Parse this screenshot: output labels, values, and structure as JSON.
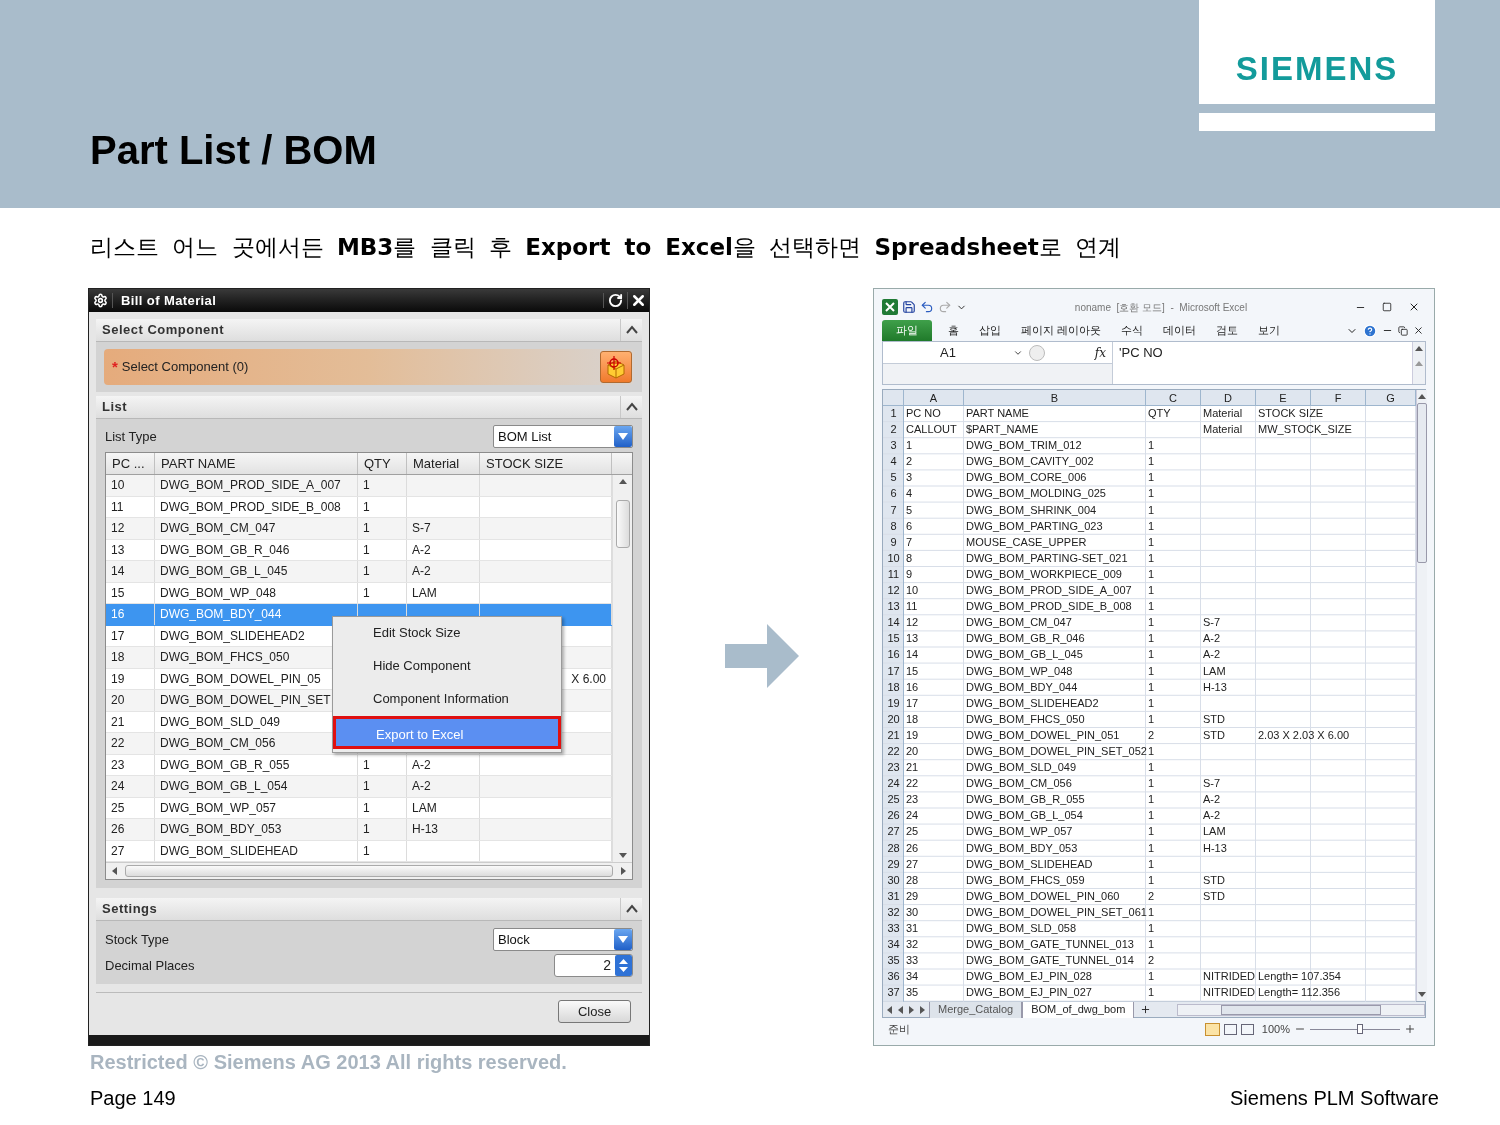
{
  "slide": {
    "title": "Part List / BOM",
    "logo": "SIEMENS",
    "subtitle": "리스트 어느 곳에서든 **MB3**를 클릭 후 **Export to Excel**을 선택하면 **Spreadsheet**로 연계",
    "footer_notice": "Restricted © Siemens AG 2013 All rights reserved.",
    "page": "Page 149",
    "company": "Siemens PLM Software"
  },
  "dialog": {
    "title": "Bill of Material",
    "select_section": {
      "title": "Select Component",
      "expanded": true,
      "required_mark": "*",
      "label": "Select Component (0)"
    },
    "list_section": {
      "title": "List",
      "expanded": true,
      "list_type_label": "List Type",
      "list_type_value": "BOM List",
      "columns": [
        "PC ...",
        "PART NAME",
        "QTY",
        "Material",
        "STOCK SIZE"
      ],
      "rows": [
        {
          "pc": "10",
          "name": "DWG_BOM_PROD_SIDE_A_007",
          "qty": "1",
          "selected": false
        },
        {
          "pc": "11",
          "name": "DWG_BOM_PROD_SIDE_B_008",
          "qty": "1",
          "selected": false
        },
        {
          "pc": "12",
          "name": "DWG_BOM_CM_047",
          "qty": "1",
          "material": "S-7",
          "selected": false
        },
        {
          "pc": "13",
          "name": "DWG_BOM_GB_R_046",
          "qty": "1",
          "material": "A-2",
          "selected": false
        },
        {
          "pc": "14",
          "name": "DWG_BOM_GB_L_045",
          "qty": "1",
          "material": "A-2",
          "selected": false
        },
        {
          "pc": "15",
          "name": "DWG_BOM_WP_048",
          "qty": "1",
          "material": "LAM",
          "selected": false
        },
        {
          "pc": "16",
          "name": "DWG_BOM_BDY_044",
          "selected": true
        },
        {
          "pc": "17",
          "name": "DWG_BOM_SLIDEHEAD2",
          "selected": false
        },
        {
          "pc": "18",
          "name": "DWG_BOM_FHCS_050",
          "selected": false
        },
        {
          "pc": "19",
          "name": "DWG_BOM_DOWEL_PIN_05",
          "stock": "X 6.00",
          "selected": false
        },
        {
          "pc": "20",
          "name": "DWG_BOM_DOWEL_PIN_SET",
          "selected": false
        },
        {
          "pc": "21",
          "name": "DWG_BOM_SLD_049",
          "selected": false
        },
        {
          "pc": "22",
          "name": "DWG_BOM_CM_056",
          "selected": false
        },
        {
          "pc": "23",
          "name": "DWG_BOM_GB_R_055",
          "qty": "1",
          "material": "A-2",
          "selected": false
        },
        {
          "pc": "24",
          "name": "DWG_BOM_GB_L_054",
          "qty": "1",
          "material": "A-2",
          "selected": false
        },
        {
          "pc": "25",
          "name": "DWG_BOM_WP_057",
          "qty": "1",
          "material": "LAM",
          "selected": false
        },
        {
          "pc": "26",
          "name": "DWG_BOM_BDY_053",
          "qty": "1",
          "material": "H-13",
          "selected": false
        },
        {
          "pc": "27",
          "name": "DWG_BOM_SLIDEHEAD",
          "qty": "1",
          "selected": false
        }
      ],
      "context_menu": [
        {
          "label": "Edit Stock Size",
          "selected": false
        },
        {
          "label": "Hide Component",
          "selected": false
        },
        {
          "label": "Component Information",
          "selected": false
        },
        {
          "label": "Export to Excel",
          "selected": true
        }
      ]
    },
    "settings_section": {
      "title": "Settings",
      "expanded": true,
      "stock_type_label": "Stock Type",
      "stock_type_value": "Block",
      "decimal_label": "Decimal Places",
      "decimal_value": "2"
    },
    "close_button": "Close"
  },
  "excel": {
    "title": "noname  [호환 모드]  -  Microsoft Excel",
    "ribbon_tabs": [
      {
        "label": "파일",
        "kind": "file"
      },
      {
        "label": "홈",
        "kind": "tab"
      },
      {
        "label": "삽입",
        "kind": "tab"
      },
      {
        "label": "페이지 레이아웃",
        "kind": "tab"
      },
      {
        "label": "수식",
        "kind": "tab"
      },
      {
        "label": "데이터",
        "kind": "tab"
      },
      {
        "label": "검토",
        "kind": "tab"
      },
      {
        "label": "보기",
        "kind": "tab"
      }
    ],
    "name_box": "A1",
    "formula": "'PC NO",
    "fx": "fx",
    "column_headers": [
      "A",
      "B",
      "C",
      "D",
      "E",
      "F",
      "G"
    ],
    "rows": [
      {
        "row": "1",
        "a": "PC NO",
        "b": "PART NAME",
        "c": "QTY",
        "d": "Material",
        "e": "STOCK SIZE"
      },
      {
        "row": "2",
        "a": "CALLOUT",
        "b": "$PART_NAME",
        "d": "Material",
        "e": "MW_STOCK_SIZE"
      },
      {
        "row": "3",
        "a": "1",
        "b": "DWG_BOM_TRIM_012",
        "c": "1"
      },
      {
        "row": "4",
        "a": "2",
        "b": "DWG_BOM_CAVITY_002",
        "c": "1"
      },
      {
        "row": "5",
        "a": "3",
        "b": "DWG_BOM_CORE_006",
        "c": "1"
      },
      {
        "row": "6",
        "a": "4",
        "b": "DWG_BOM_MOLDING_025",
        "c": "1"
      },
      {
        "row": "7",
        "a": "5",
        "b": "DWG_BOM_SHRINK_004",
        "c": "1"
      },
      {
        "row": "8",
        "a": "6",
        "b": "DWG_BOM_PARTING_023",
        "c": "1"
      },
      {
        "row": "9",
        "a": "7",
        "b": "MOUSE_CASE_UPPER",
        "c": "1"
      },
      {
        "row": "10",
        "a": "8",
        "b": "DWG_BOM_PARTING-SET_021",
        "c": "1"
      },
      {
        "row": "11",
        "a": "9",
        "b": "DWG_BOM_WORKPIECE_009",
        "c": "1"
      },
      {
        "row": "12",
        "a": "10",
        "b": "DWG_BOM_PROD_SIDE_A_007",
        "c": "1"
      },
      {
        "row": "13",
        "a": "11",
        "b": "DWG_BOM_PROD_SIDE_B_008",
        "c": "1"
      },
      {
        "row": "14",
        "a": "12",
        "b": "DWG_BOM_CM_047",
        "c": "1",
        "d": "S-7"
      },
      {
        "row": "15",
        "a": "13",
        "b": "DWG_BOM_GB_R_046",
        "c": "1",
        "d": "A-2"
      },
      {
        "row": "16",
        "a": "14",
        "b": "DWG_BOM_GB_L_045",
        "c": "1",
        "d": "A-2"
      },
      {
        "row": "17",
        "a": "15",
        "b": "DWG_BOM_WP_048",
        "c": "1",
        "d": "LAM"
      },
      {
        "row": "18",
        "a": "16",
        "b": "DWG_BOM_BDY_044",
        "c": "1",
        "d": "H-13"
      },
      {
        "row": "19",
        "a": "17",
        "b": "DWG_BOM_SLIDEHEAD2",
        "c": "1"
      },
      {
        "row": "20",
        "a": "18",
        "b": "DWG_BOM_FHCS_050",
        "c": "1",
        "d": "STD"
      },
      {
        "row": "21",
        "a": "19",
        "b": "DWG_BOM_DOWEL_PIN_051",
        "c": "2",
        "d": "STD",
        "e": "2.03 X 2.03 X 6.00"
      },
      {
        "row": "22",
        "a": "20",
        "b": "DWG_BOM_DOWEL_PIN_SET_052",
        "c": "1"
      },
      {
        "row": "23",
        "a": "21",
        "b": "DWG_BOM_SLD_049",
        "c": "1"
      },
      {
        "row": "24",
        "a": "22",
        "b": "DWG_BOM_CM_056",
        "c": "1",
        "d": "S-7"
      },
      {
        "row": "25",
        "a": "23",
        "b": "DWG_BOM_GB_R_055",
        "c": "1",
        "d": "A-2"
      },
      {
        "row": "26",
        "a": "24",
        "b": "DWG_BOM_GB_L_054",
        "c": "1",
        "d": "A-2"
      },
      {
        "row": "27",
        "a": "25",
        "b": "DWG_BOM_WP_057",
        "c": "1",
        "d": "LAM"
      },
      {
        "row": "28",
        "a": "26",
        "b": "DWG_BOM_BDY_053",
        "c": "1",
        "d": "H-13"
      },
      {
        "row": "29",
        "a": "27",
        "b": "DWG_BOM_SLIDEHEAD",
        "c": "1"
      },
      {
        "row": "30",
        "a": "28",
        "b": "DWG_BOM_FHCS_059",
        "c": "1",
        "d": "STD"
      },
      {
        "row": "31",
        "a": "29",
        "b": "DWG_BOM_DOWEL_PIN_060",
        "c": "2",
        "d": "STD"
      },
      {
        "row": "32",
        "a": "30",
        "b": "DWG_BOM_DOWEL_PIN_SET_061",
        "c": "1"
      },
      {
        "row": "33",
        "a": "31",
        "b": "DWG_BOM_SLD_058",
        "c": "1"
      },
      {
        "row": "34",
        "a": "32",
        "b": "DWG_BOM_GATE_TUNNEL_013",
        "c": "1"
      },
      {
        "row": "35",
        "a": "33",
        "b": "DWG_BOM_GATE_TUNNEL_014",
        "c": "2"
      },
      {
        "row": "36",
        "a": "34",
        "b": "DWG_BOM_EJ_PIN_028",
        "c": "1",
        "d": "NITRIDED",
        "e": "Length= 107.354"
      },
      {
        "row": "37",
        "a": "35",
        "b": "DWG_BOM_EJ_PIN_027",
        "c": "1",
        "d": "NITRIDED",
        "e": "Length= 112.356"
      }
    ],
    "sheet_tabs": [
      {
        "label": "Merge_Catalog",
        "selected": false
      },
      {
        "label": "BOM_of_dwg_bom",
        "selected": true
      }
    ],
    "status": "준비",
    "zoom": "100%",
    "zoom_slider": {
      "level": 0.55
    }
  }
}
